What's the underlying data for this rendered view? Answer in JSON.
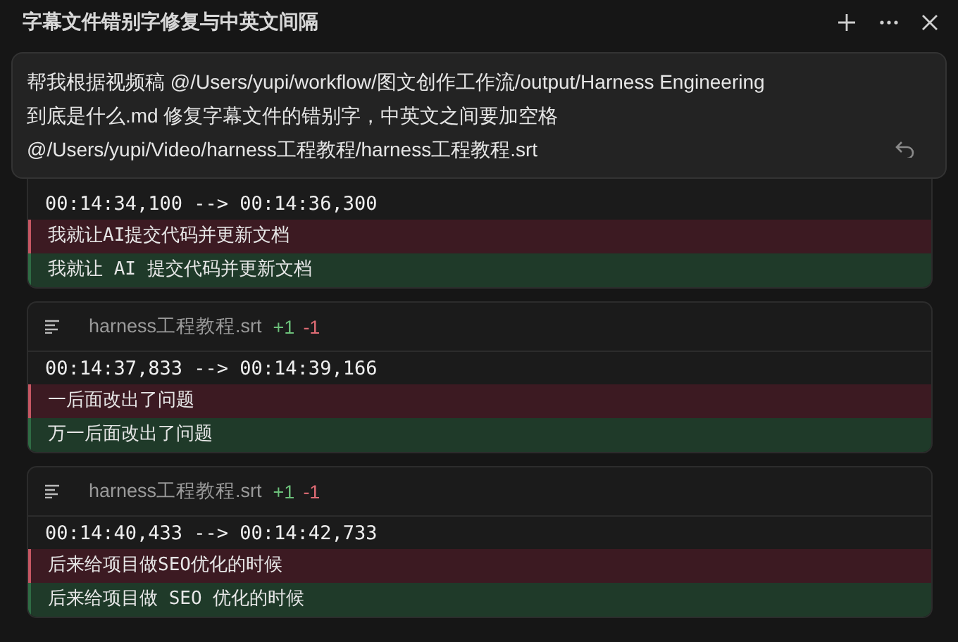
{
  "window": {
    "title": "字幕文件错别字修复与中英文间隔"
  },
  "prompt": {
    "lines": [
      "帮我根据视频稿 @/Users/yupi/workflow/图文创作工作流/output/Harness Engineering",
      "到底是什么.md 修复字幕文件的错别字，中英文之间要加空格",
      "@/Users/yupi/Video/harness工程教程/harness工程教程.srt"
    ]
  },
  "diffs": [
    {
      "timestamp": "00:14:34,100 --> 00:14:36,300",
      "lines": [
        {
          "kind": "removed",
          "text": "我就让AI提交代码并更新文档"
        },
        {
          "kind": "added",
          "text": "我就让 AI 提交代码并更新文档"
        }
      ]
    },
    {
      "file": "harness工程教程.srt",
      "added": "+1",
      "removed": "-1",
      "timestamp": "00:14:37,833 --> 00:14:39,166",
      "lines": [
        {
          "kind": "removed",
          "text": "一后面改出了问题"
        },
        {
          "kind": "added",
          "text": "万一后面改出了问题"
        }
      ]
    },
    {
      "file": "harness工程教程.srt",
      "added": "+1",
      "removed": "-1",
      "timestamp": "00:14:40,433 --> 00:14:42,733",
      "lines": [
        {
          "kind": "removed",
          "text": "后来给项目做SEO优化的时候"
        },
        {
          "kind": "added",
          "text": "后来给项目做 SEO 优化的时候"
        }
      ]
    }
  ]
}
